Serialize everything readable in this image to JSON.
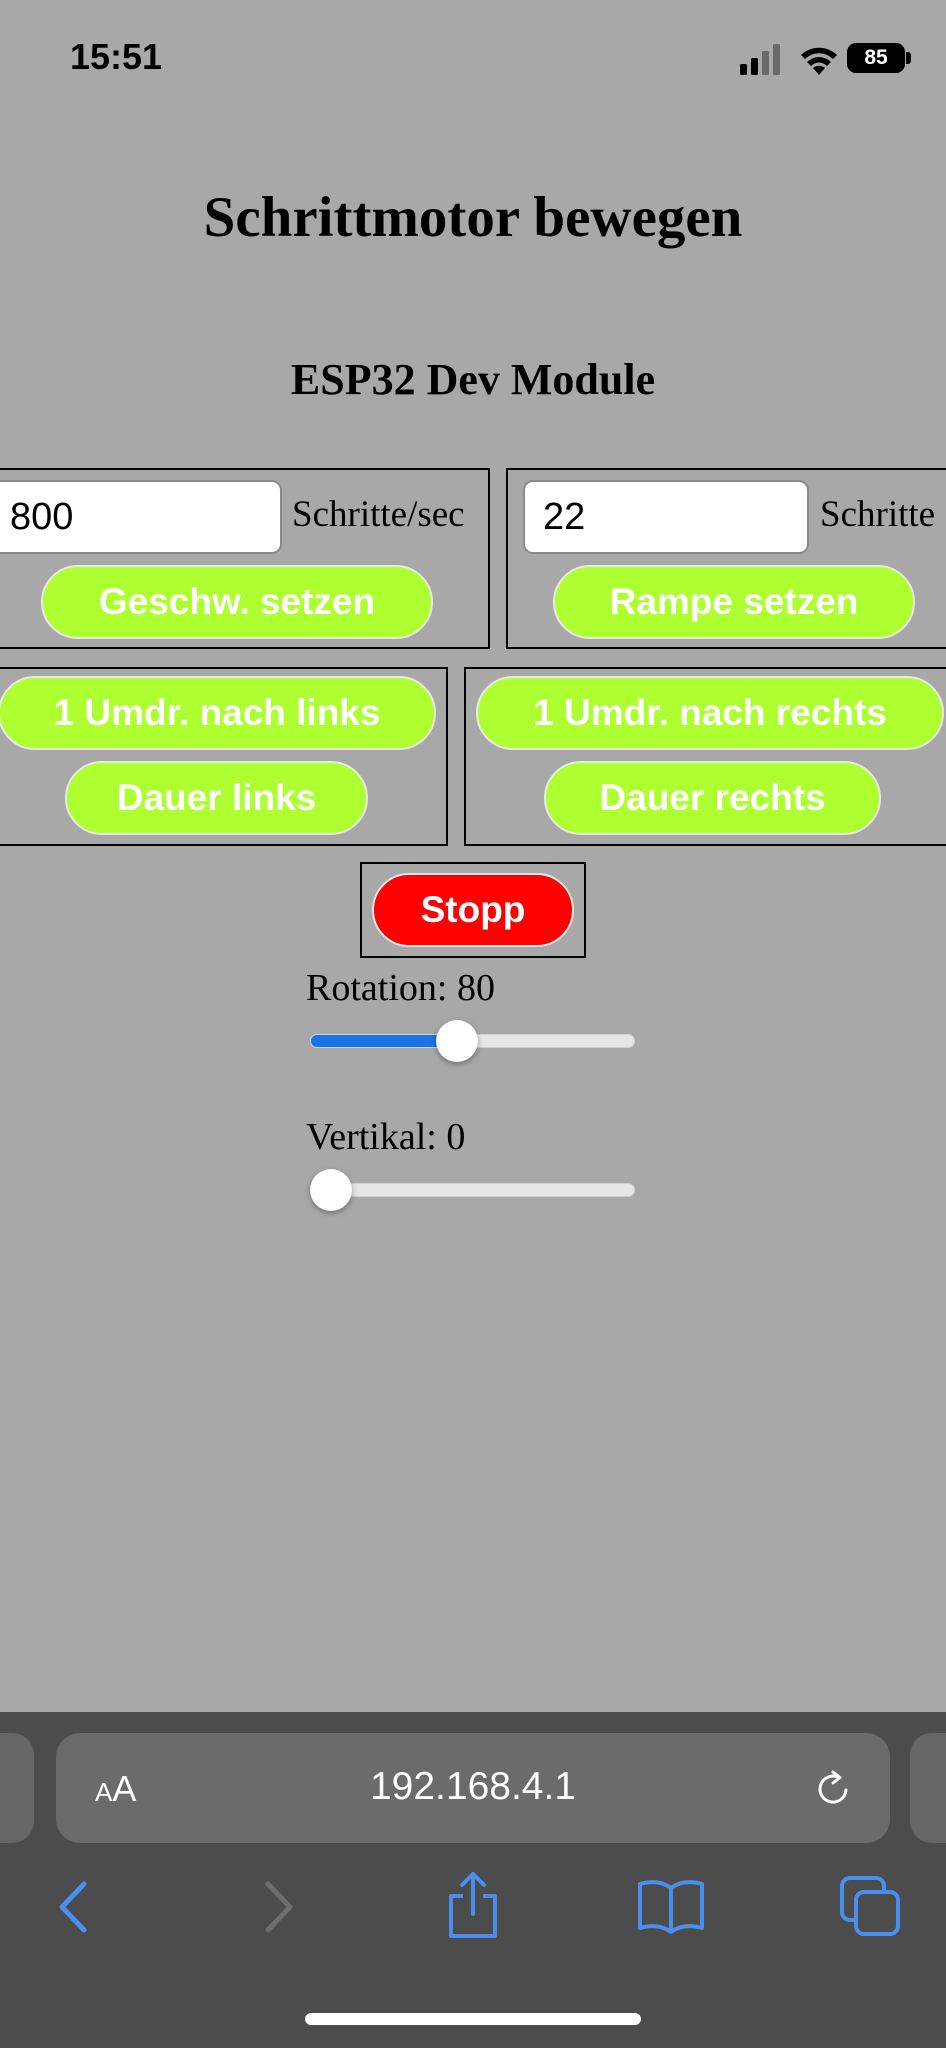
{
  "status_bar": {
    "time": "15:51",
    "battery": "85"
  },
  "page": {
    "title": "Schrittmotor bewegen",
    "subtitle": "ESP32 Dev Module"
  },
  "speed": {
    "value": "800",
    "unit": "Schritte/sec",
    "button": "Geschw. setzen"
  },
  "ramp": {
    "value": "22",
    "unit": "Schritte",
    "button": "Rampe setzen"
  },
  "left_controls": {
    "one_rev": "1 Umdr. nach links",
    "continuous": "Dauer links"
  },
  "right_controls": {
    "one_rev": "1 Umdr. nach rechts",
    "continuous": "Dauer rechts"
  },
  "stop": {
    "label": "Stopp"
  },
  "sliders": {
    "rotation": {
      "label": "Rotation: 80",
      "value": 80,
      "min": 0,
      "max": 180
    },
    "vertical": {
      "label": "Vertikal: 0",
      "value": 0,
      "min": 0,
      "max": 180
    }
  },
  "browser": {
    "text_size_small": "A",
    "text_size_large": "A",
    "url": "192.168.4.1"
  },
  "colors": {
    "page_background": "#a8a8a8",
    "action_button": "#adff2f",
    "stop_button": "#ff0000",
    "slider_fill": "#1a73e8",
    "toolbar_icon": "#4a8ff0"
  }
}
